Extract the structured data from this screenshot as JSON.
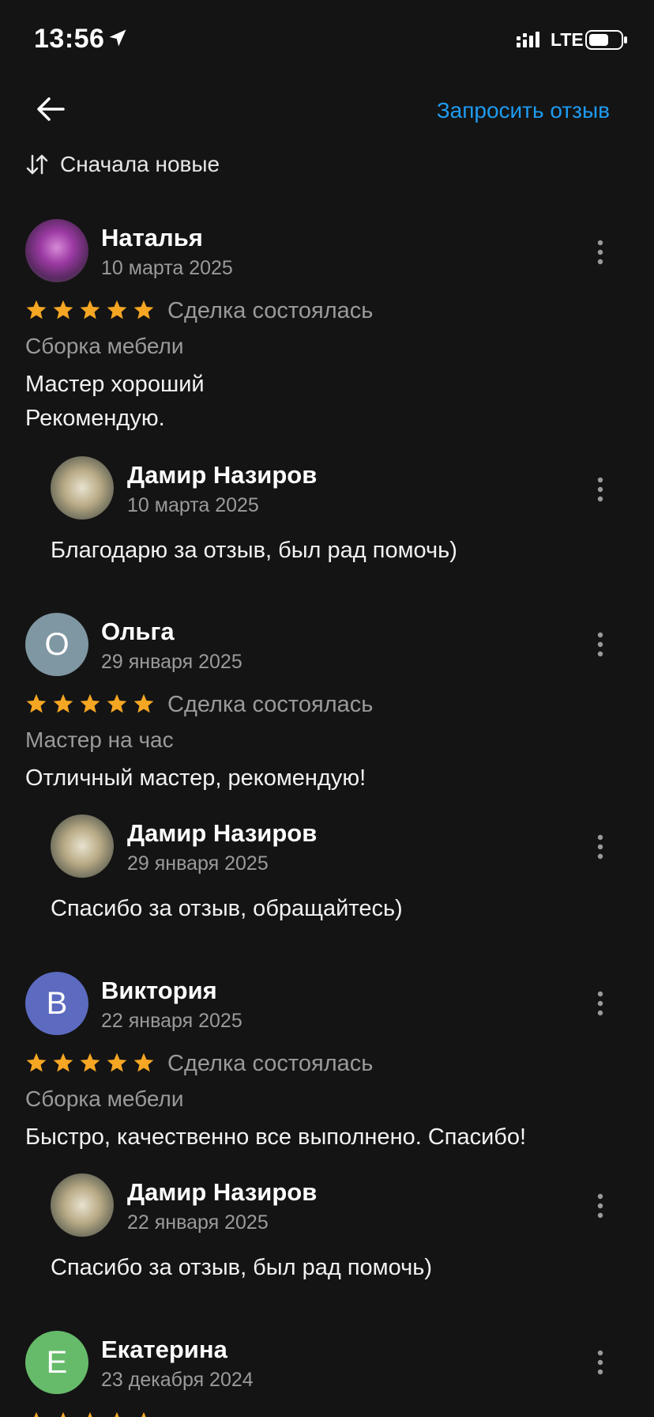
{
  "status": {
    "time": "13:56",
    "network": "LTE"
  },
  "header": {
    "request_label": "Запросить отзыв"
  },
  "sort": {
    "label": "Сначала новые"
  },
  "colors": {
    "accent": "#1e9bf0",
    "star": "#f5a623"
  },
  "reviews": [
    {
      "author": "Наталья",
      "avatar_letter": "",
      "avatar_color": "#7b3f8a",
      "date": "10 марта 2025",
      "rating": 5,
      "deal": "Сделка состоялась",
      "category": "Сборка мебели",
      "text": "Мастер хороший\nРекомендую.",
      "reply": {
        "author": "Дамир  Назиров",
        "date": "10 марта 2025",
        "text": "Благодарю за отзыв, был рад помочь)"
      }
    },
    {
      "author": "Ольга",
      "avatar_letter": "О",
      "avatar_color": "#7f97a3",
      "date": "29 января 2025",
      "rating": 5,
      "deal": "Сделка состоялась",
      "category": "Мастер на час",
      "text": "Отличный мастер, рекомендую!",
      "reply": {
        "author": "Дамир  Назиров",
        "date": "29 января 2025",
        "text": "Спасибо за отзыв, обращайтесь)"
      }
    },
    {
      "author": "Виктория",
      "avatar_letter": "В",
      "avatar_color": "#5c6bc0",
      "date": "22 января 2025",
      "rating": 5,
      "deal": "Сделка состоялась",
      "category": "Сборка мебели",
      "text": "Быстро, качественно все выполнено.  Спасибо!",
      "reply": {
        "author": "Дамир  Назиров",
        "date": "22 января 2025",
        "text": "Спасибо за отзыв, был рад помочь)"
      }
    },
    {
      "author": "Екатерина",
      "avatar_letter": "Е",
      "avatar_color": "#66bb6a",
      "date": "23 декабря 2024",
      "rating": 5
    }
  ]
}
